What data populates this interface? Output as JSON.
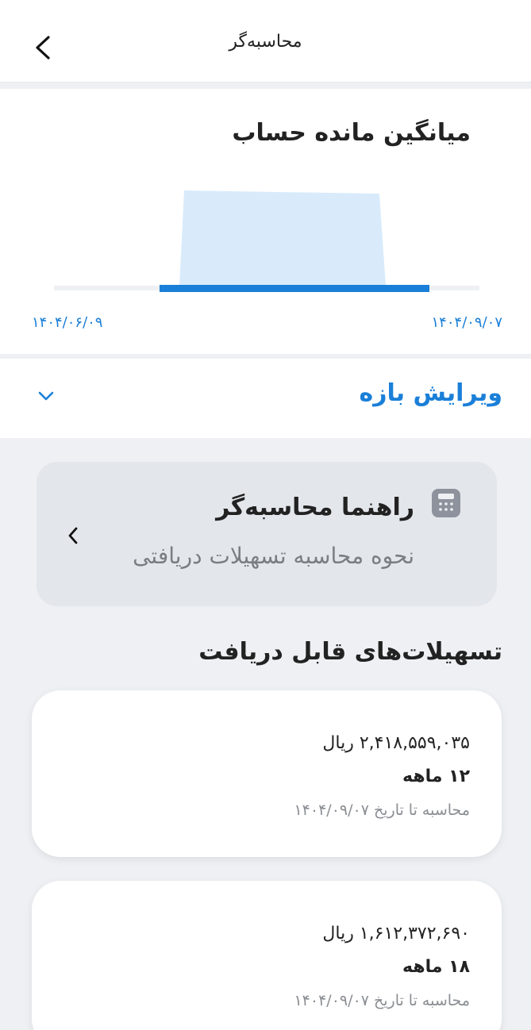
{
  "header": {
    "title": "محاسبه‌گر",
    "back_icon": "chevron-left-icon"
  },
  "chart": {
    "title": "میانگین مانده حساب",
    "start_date": "۱۴۰۴/۰۶/۰۹",
    "end_date": "۱۴۰۴/۰۹/۰۷",
    "accent_color": "#1a7fd8",
    "fill_color": "#d9ebfb"
  },
  "chart_data": {
    "type": "area",
    "title": "میانگین مانده حساب",
    "x_labels": [
      "۱۴۰۴/۰۶/۰۹",
      "۱۴۰۴/۰۹/۰۷"
    ],
    "grid": false
  },
  "range": {
    "label": "ویرایش بازه",
    "icon": "chevron-down-icon"
  },
  "guide": {
    "title": "راهنما محاسبه‌گر",
    "subtitle": "نحوه محاسبه تسهیلات دریافتی",
    "icon": "calculator-icon"
  },
  "section": {
    "title": "تسهیلات‌های قابل دریافت"
  },
  "loans": [
    {
      "amount": "۲,۴۱۸,۵۵۹,۰۳۵ ریال",
      "term": "۱۲ ماهه",
      "date_note": "محاسبه تا تاریخ ۱۴۰۴/۰۹/۰۷"
    },
    {
      "amount": "۱,۶۱۲,۳۷۲,۶۹۰ ریال",
      "term": "۱۸ ماهه",
      "date_note": "محاسبه تا تاریخ ۱۴۰۴/۰۹/۰۷"
    }
  ]
}
